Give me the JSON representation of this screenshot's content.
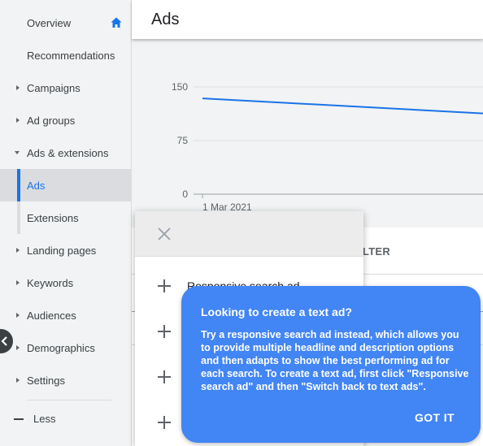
{
  "sidebar": {
    "items": [
      {
        "label": "Overview"
      },
      {
        "label": "Recommendations"
      },
      {
        "label": "Campaigns"
      },
      {
        "label": "Ad groups"
      },
      {
        "label": "Ads & extensions"
      },
      {
        "label": "Ads"
      },
      {
        "label": "Extensions"
      },
      {
        "label": "Landing pages"
      },
      {
        "label": "Keywords"
      },
      {
        "label": "Audiences"
      },
      {
        "label": "Demographics"
      },
      {
        "label": "Settings"
      }
    ],
    "less_label": "Less"
  },
  "header": {
    "title": "Ads"
  },
  "chart_data": {
    "type": "line",
    "x": [
      "1 Mar 2021",
      ""
    ],
    "series": [
      {
        "values": [
          134,
          113
        ]
      }
    ],
    "y_ticks": [
      "150",
      "75",
      "0"
    ],
    "ylim": [
      0,
      150
    ],
    "x_tick_labels": [
      "1 Mar 2021"
    ],
    "color": "#1a73e8"
  },
  "table": {
    "filter_label": "ILTER"
  },
  "ad_menu": {
    "rows": [
      {
        "label": "Responsive search ad"
      },
      {
        "label": ""
      },
      {
        "label": ""
      },
      {
        "label": ""
      }
    ]
  },
  "callout": {
    "title": "Looking to create a text ad?",
    "body": "Try a responsive search ad instead, which allows you to provide multiple headline and description options and then adapts to show the best performing ad for each search. To create a text ad, first click \"Responsive search ad\" and then \"Switch back to text ads\".",
    "button_label": "GOT IT"
  },
  "colors": {
    "accent": "#1a73e8",
    "callout": "#4285f4"
  }
}
